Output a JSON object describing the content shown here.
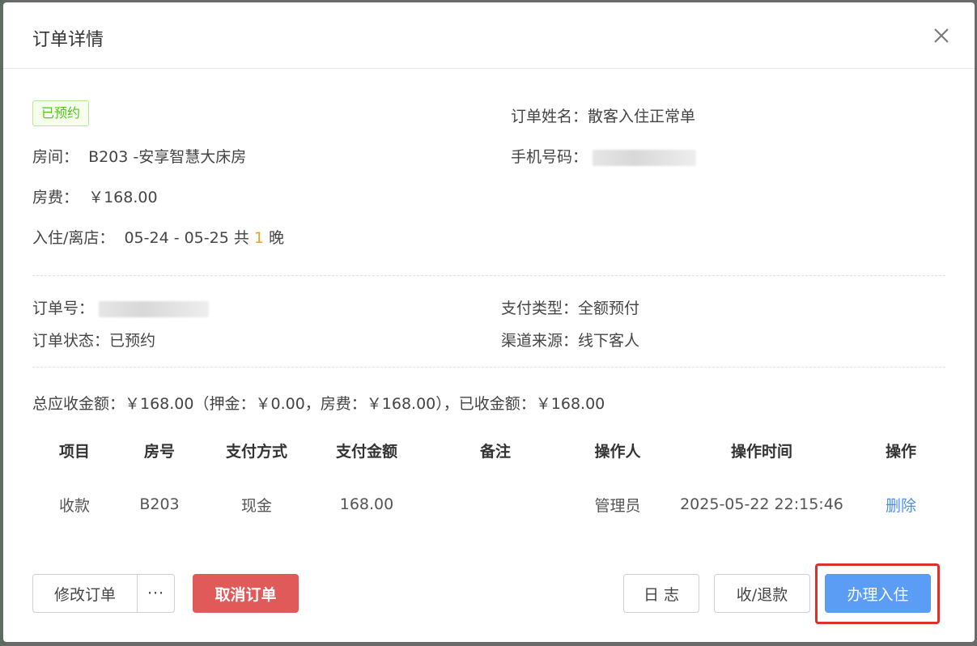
{
  "dialog": {
    "title": "订单详情",
    "close_icon": "close-icon"
  },
  "status_tag": "已预约",
  "info": {
    "order_name_label": "订单姓名：",
    "order_name_value": "散客入住正常单",
    "room_label": "房间：",
    "room_value": "B203 -安享智慧大床房",
    "phone_label": "手机号码：",
    "fee_label": "房费：",
    "fee_value": "￥168.00",
    "stay_label": "入住/离店：",
    "stay_dates": "05-24 - 05-25 共",
    "stay_nights": "1",
    "stay_unit": "晚"
  },
  "order": {
    "order_no_label": "订单号：",
    "pay_type_label": "支付类型：",
    "pay_type_value": "全额预付",
    "status_label": "订单状态：",
    "status_value": "已预约",
    "channel_label": "渠道来源：",
    "channel_value": "线下客人"
  },
  "summary": "总应收金额：￥168.00（押金：￥0.00，房费：￥168.00），已收金额：￥168.00",
  "table": {
    "headers": [
      "项目",
      "房号",
      "支付方式",
      "支付金额",
      "备注",
      "操作人",
      "操作时间",
      "操作"
    ],
    "rows": [
      [
        "收款",
        "B203",
        "现金",
        "168.00",
        "",
        "管理员",
        "2025-05-22 22:15:46",
        "删除"
      ]
    ]
  },
  "footer": {
    "modify_label": "修改订单",
    "more_label": "···",
    "cancel_label": "取消订单",
    "log_label": "日 志",
    "refund_label": "收/退款",
    "checkin_label": "办理入住"
  },
  "colors": {
    "primary": "#5b9cf5",
    "danger": "#e05a5a",
    "success": "#52c41a",
    "highlight": "#e0302a",
    "nights": "#f0a020"
  }
}
